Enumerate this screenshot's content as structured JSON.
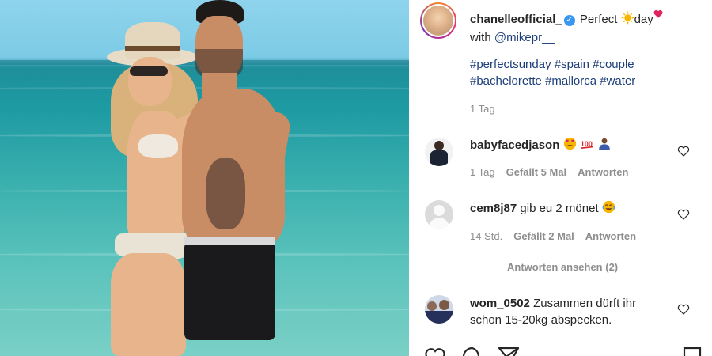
{
  "post": {
    "author": "chanelleofficial_",
    "caption_prefix": "Perfect",
    "caption_suffix": "day",
    "with_text": "with",
    "mention": "@mikepr__",
    "hashtags_line1": "#perfectsunday #spain #couple",
    "hashtags_line2": "#bachelorette #mallorca #water",
    "time": "1 Tag"
  },
  "comments": [
    {
      "user": "babyfacedjason",
      "text": "",
      "time": "1 Tag",
      "likes": "Gefällt 5 Mal",
      "reply": "Antworten"
    },
    {
      "user": "cem8j87",
      "text": "gib eu 2 mönet",
      "time": "14 Std.",
      "likes": "Gefällt 2 Mal",
      "reply": "Antworten"
    },
    {
      "user": "wom_0502",
      "text_line1": "Zusammen dürft ihr",
      "text_line2": "schon 15-20kg abspecken."
    }
  ],
  "view_replies": "Antworten ansehen (2)",
  "icons": [
    "verified-badge",
    "sun-emoji",
    "heart-emoji",
    "heart-eyes-emoji",
    "hundred-emoji",
    "person-emoji",
    "tears-of-joy-emoji",
    "like-heart-icon",
    "comment-icon",
    "share-icon",
    "bookmark-icon"
  ],
  "colors": {
    "link": "#1d3f7a",
    "muted": "#8e8e8e",
    "verified": "#3897f0",
    "text": "#262626"
  }
}
